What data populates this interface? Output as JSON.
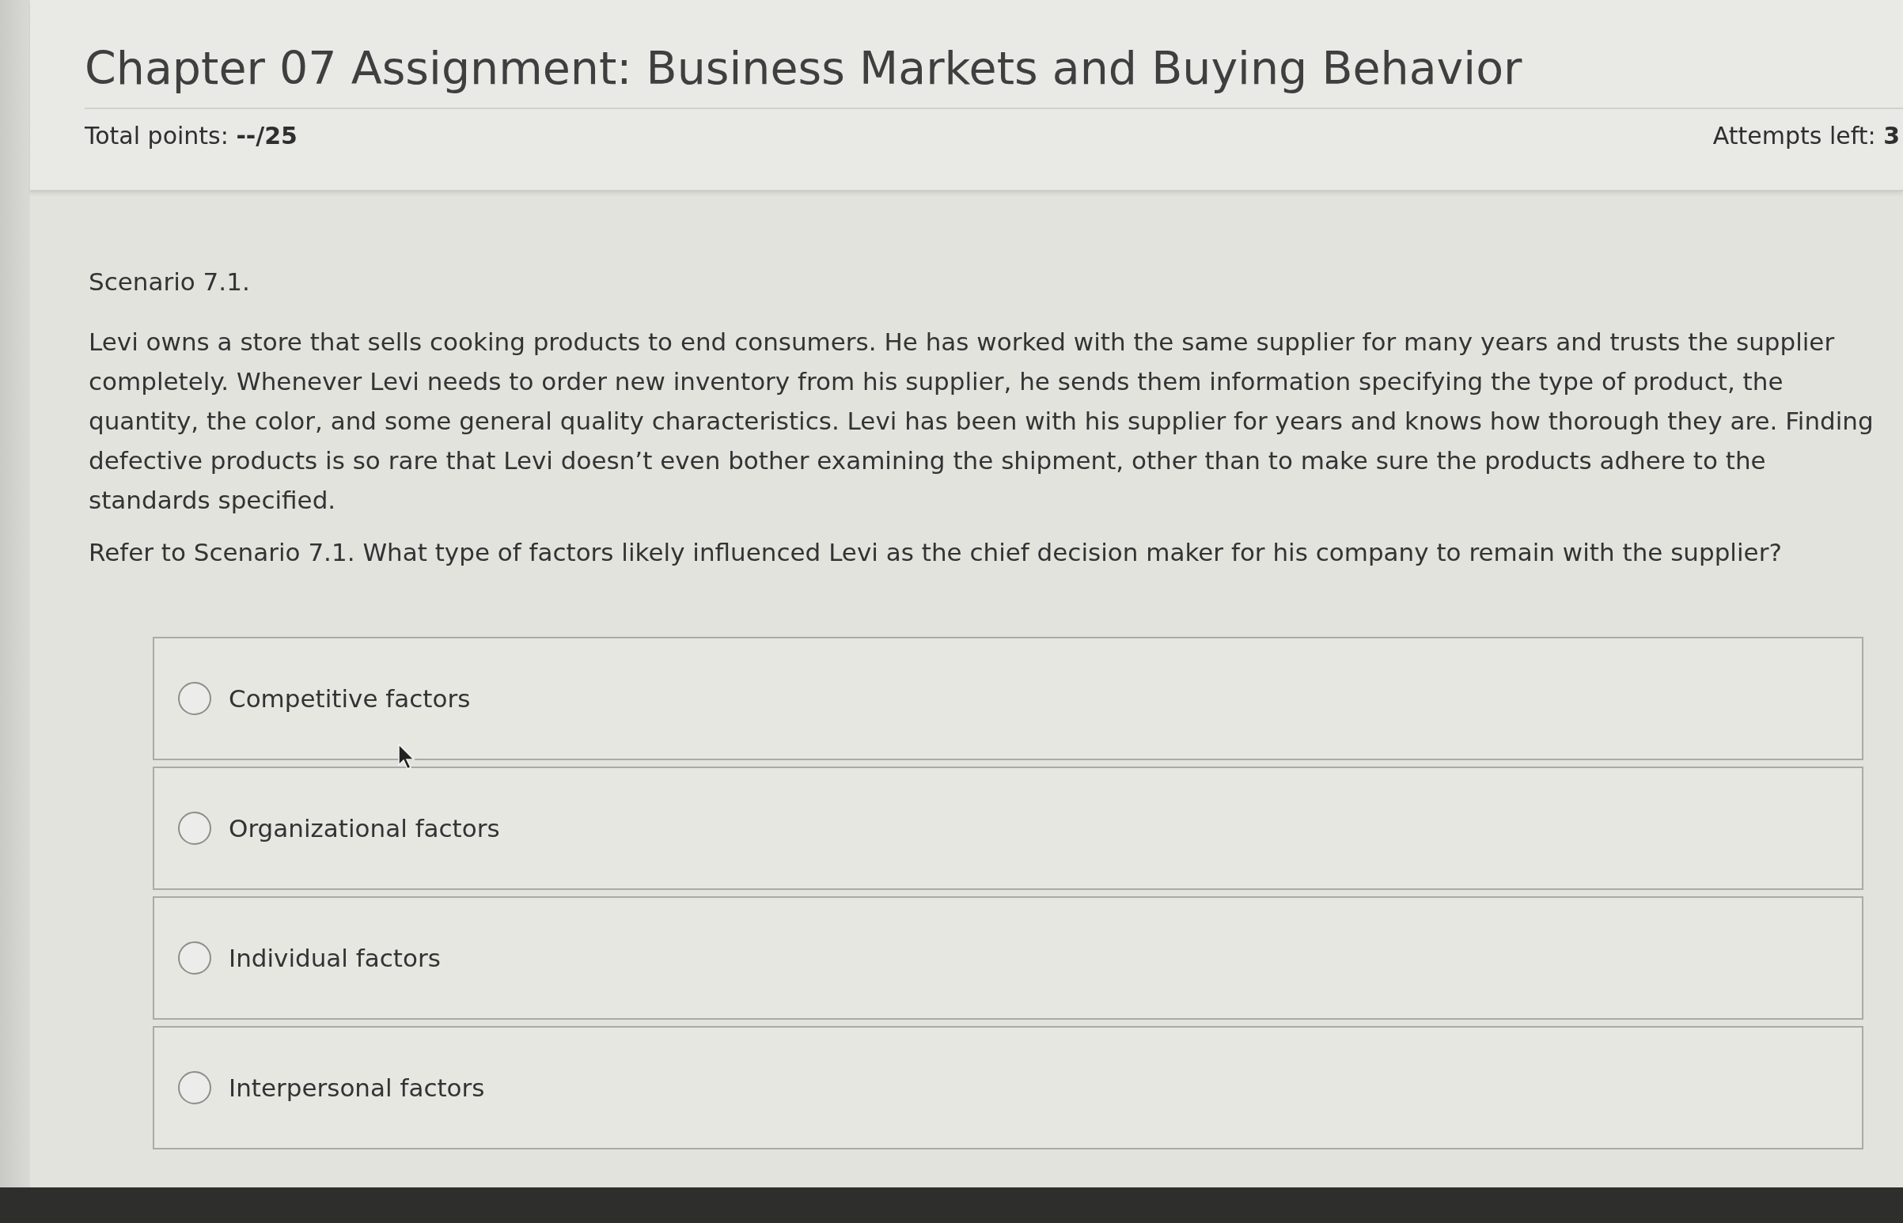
{
  "header": {
    "title": "Chapter 07 Assignment: Business Markets and Buying Behavior",
    "total_points": "Total points: **--/25**",
    "attempts": "Attempts left: **3**"
  },
  "question": {
    "scenario_title": "Scenario 7.1.",
    "scenario_text": "Levi owns a store that sells cooking products to end consumers. He has worked with the same supplier for many years and trusts the supplier completely. Whenever Levi needs to order new inventory from his supplier, he sends them information specifying the type of product, the quantity, the color, and some general quality characteristics. Levi has been with his supplier for years and knows how thorough they are. Finding defective products is so rare that Levi doesn’t even bother examining the shipment, other than to make sure the products adhere to the standards specified.",
    "prompt": "Refer to Scenario 7.1. What type of factors likely influenced Levi as the chief decision maker for his company to remain with the supplier?"
  },
  "options": [
    {
      "label": "Competitive factors",
      "selected": false
    },
    {
      "label": "Organizational factors",
      "selected": false
    },
    {
      "label": "Individual factors",
      "selected": false
    },
    {
      "label": "Interpersonal factors",
      "selected": false
    }
  ]
}
